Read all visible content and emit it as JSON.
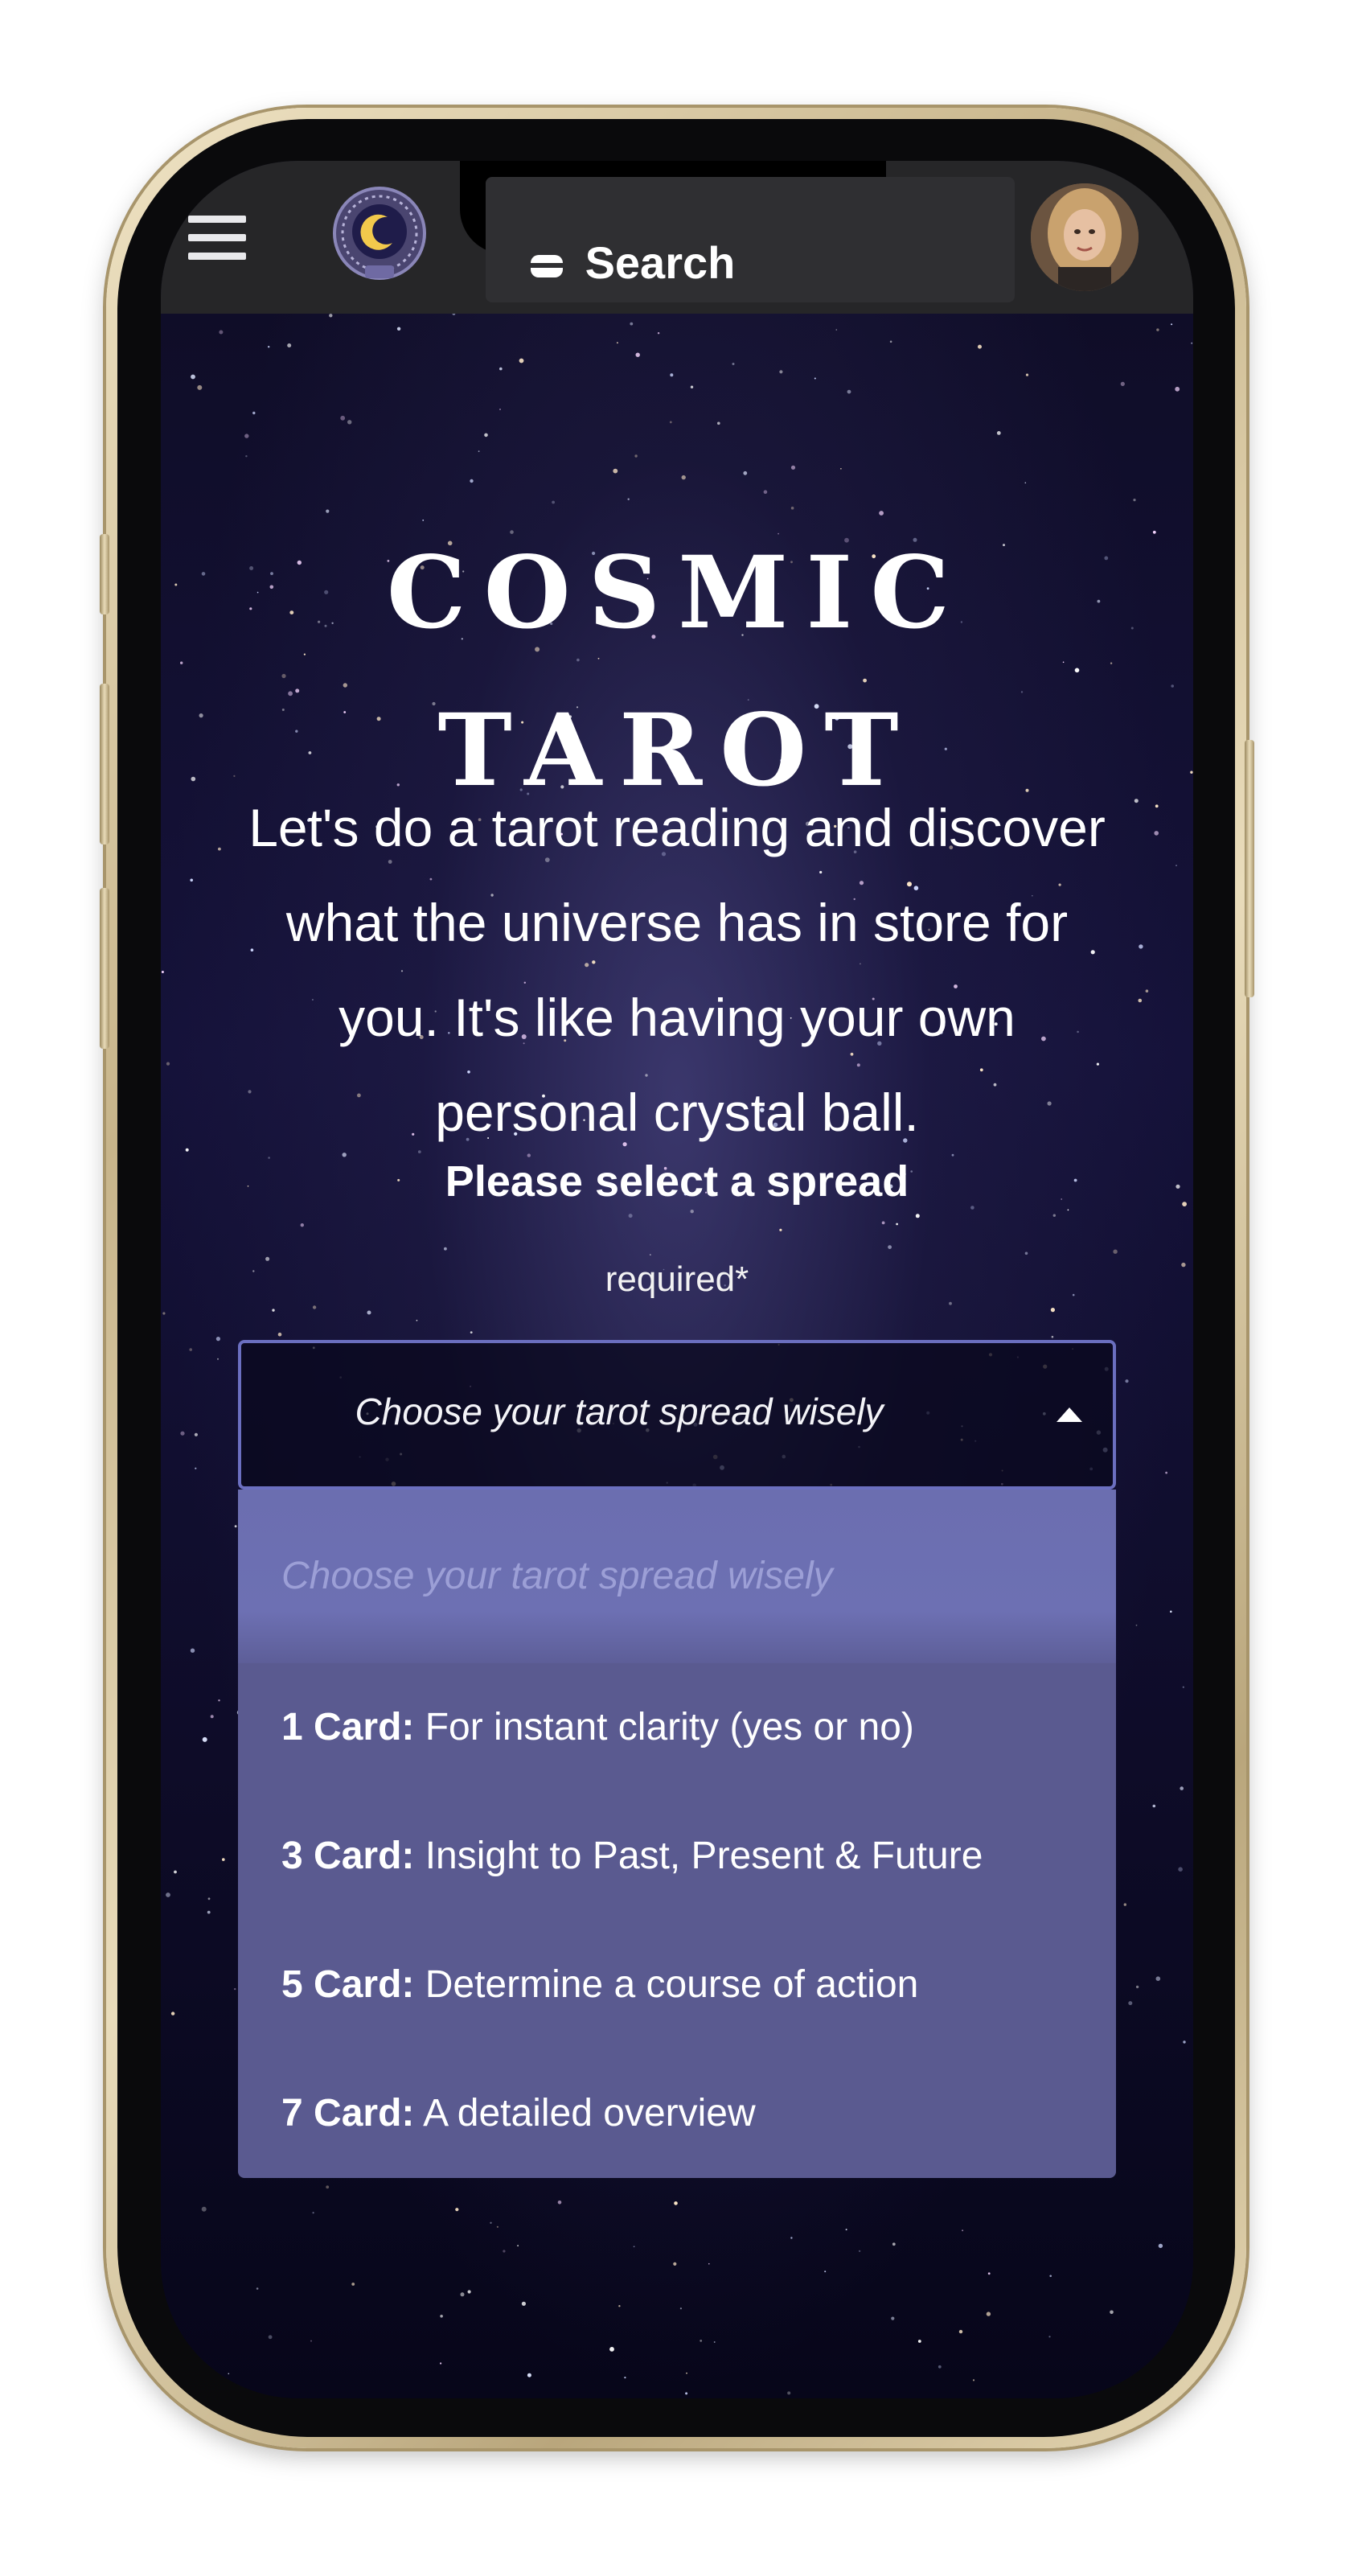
{
  "header": {
    "menu_icon": "hamburger-menu-icon",
    "logo_icon": "crystal-ball-moon-logo",
    "search_label": "Search",
    "avatar": "user-avatar"
  },
  "page": {
    "title_line1": "COSMIC",
    "title_line2": "TAROT",
    "subtitle": "Let's do a tarot reading and discover what the universe has in store for you. It's like having your own personal crystal ball."
  },
  "spread_select": {
    "label": "Please select a spread",
    "required_note": "required*",
    "current_value": "Choose your tarot spread wisely",
    "placeholder_option": "Choose your tarot spread wisely",
    "options": [
      {
        "count": "1 Card:",
        "description": " For instant clarity (yes or no)"
      },
      {
        "count": "3 Card:",
        "description": " Insight to Past, Present & Future"
      },
      {
        "count": "5 Card:",
        "description": " Determine a course of action"
      },
      {
        "count": "7 Card:",
        "description": " A detailed overview"
      }
    ]
  },
  "colors": {
    "background_top": "#0e0c24",
    "background_glow": "#5a5696",
    "topbar": "#262628",
    "select_border": "#6b6fc0",
    "dropdown_bg": "#5a5a90",
    "dropdown_placeholder_bg": "#6b6eb0",
    "phone_frame": "#d9c9a3"
  }
}
